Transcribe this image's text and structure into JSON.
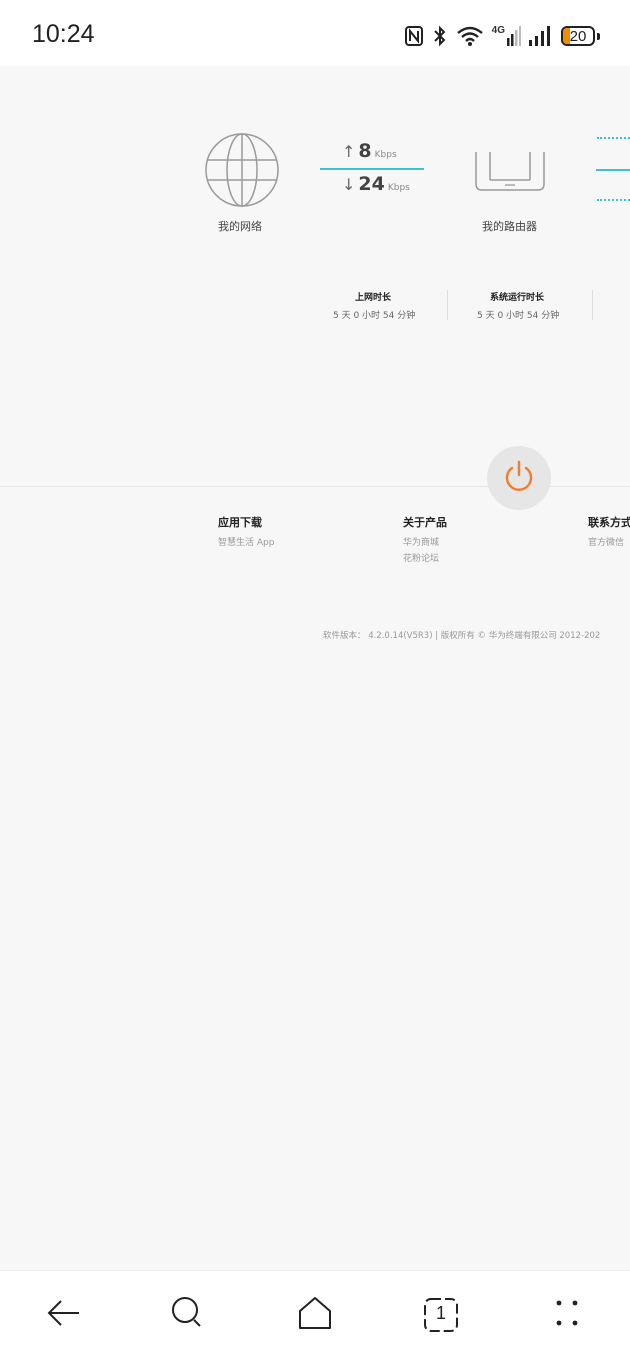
{
  "status_bar": {
    "time": "10:24",
    "network": "4G",
    "battery": "20",
    "battery_color": "#f08c00"
  },
  "topology": {
    "my_network_label": "我的网络",
    "my_router_label": "我的路由器",
    "upload": {
      "value": "8",
      "unit": "Kbps"
    },
    "download": {
      "value": "24",
      "unit": "Kbps"
    },
    "accent_color": "#3cc2c8"
  },
  "stats": {
    "online_duration": {
      "title": "上网时长",
      "value": "5 天 0 小时 54 分钟"
    },
    "system_uptime": {
      "title": "系统运行时长",
      "value": "5 天 0 小时 54 分钟"
    }
  },
  "power_color": "#f07c2e",
  "footer": {
    "app_download": {
      "title": "应用下载",
      "items": [
        "智慧生活 App"
      ]
    },
    "about_product": {
      "title": "关于产品",
      "items": [
        "华为商城",
        "花粉论坛"
      ]
    },
    "contact": {
      "title": "联系方式",
      "items": [
        "官方微信"
      ]
    },
    "version_text": "软件版本：  4.2.0.14(V5R3)  |  版权所有 © 华为终端有限公司 2012-202"
  },
  "nav_bar": {
    "tab_count": "1"
  }
}
